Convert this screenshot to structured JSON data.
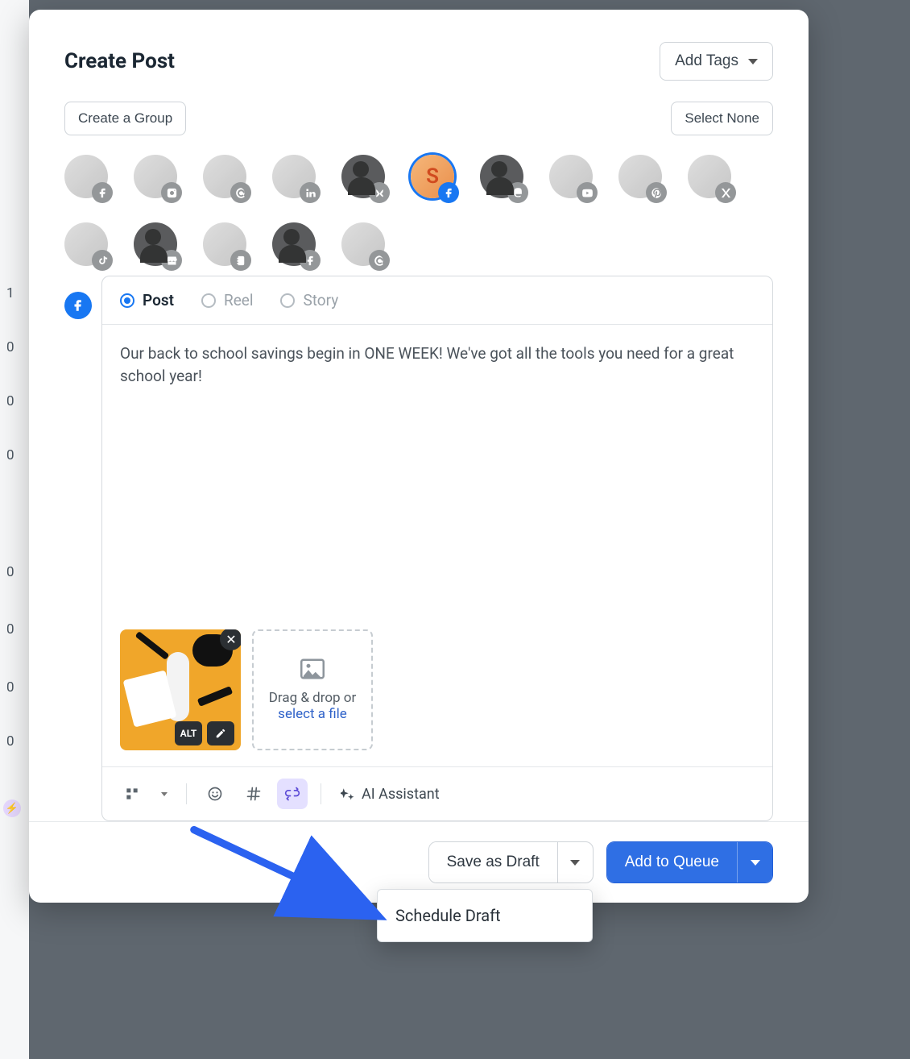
{
  "header": {
    "title": "Create Post",
    "add_tags_label": "Add Tags"
  },
  "controls": {
    "create_group_label": "Create a Group",
    "select_none_label": "Select None"
  },
  "accounts": [
    {
      "network": "facebook",
      "selected": false
    },
    {
      "network": "instagram",
      "selected": false
    },
    {
      "network": "threads",
      "selected": false
    },
    {
      "network": "linkedin",
      "selected": false
    },
    {
      "network": "bluesky",
      "selected": false,
      "dark": true
    },
    {
      "network": "facebook",
      "selected": true
    },
    {
      "network": "mastodon",
      "selected": false,
      "dark": true
    },
    {
      "network": "youtube",
      "selected": false
    },
    {
      "network": "pinterest",
      "selected": false
    },
    {
      "network": "x",
      "selected": false
    },
    {
      "network": "tiktok",
      "selected": false
    },
    {
      "network": "google-business",
      "selected": false,
      "dark": true
    },
    {
      "network": "contacts",
      "selected": false
    },
    {
      "network": "facebook",
      "selected": false,
      "dark": true
    },
    {
      "network": "threads",
      "selected": false
    }
  ],
  "composer": {
    "tabs": {
      "post": "Post",
      "reel": "Reel",
      "story": "Story",
      "active": "post"
    },
    "body_text": "Our back to school savings begin in ONE WEEK! We've got all the tools you need for a great school year!",
    "media": {
      "alt_label": "ALT",
      "dropzone_line1": "Drag & drop or ",
      "dropzone_link": "select a file"
    },
    "toolbar": {
      "ai_assistant_label": "AI Assistant"
    }
  },
  "footer": {
    "save_draft_label": "Save as Draft",
    "add_to_queue_label": "Add to Queue"
  },
  "dropdown": {
    "schedule_draft_label": "Schedule Draft"
  },
  "sidebar_numbers": [
    "1",
    "0",
    "0",
    "0",
    "0",
    "0",
    "0",
    "0"
  ],
  "colors": {
    "primary_blue": "#2f6fe4",
    "facebook_blue": "#1877f2"
  }
}
